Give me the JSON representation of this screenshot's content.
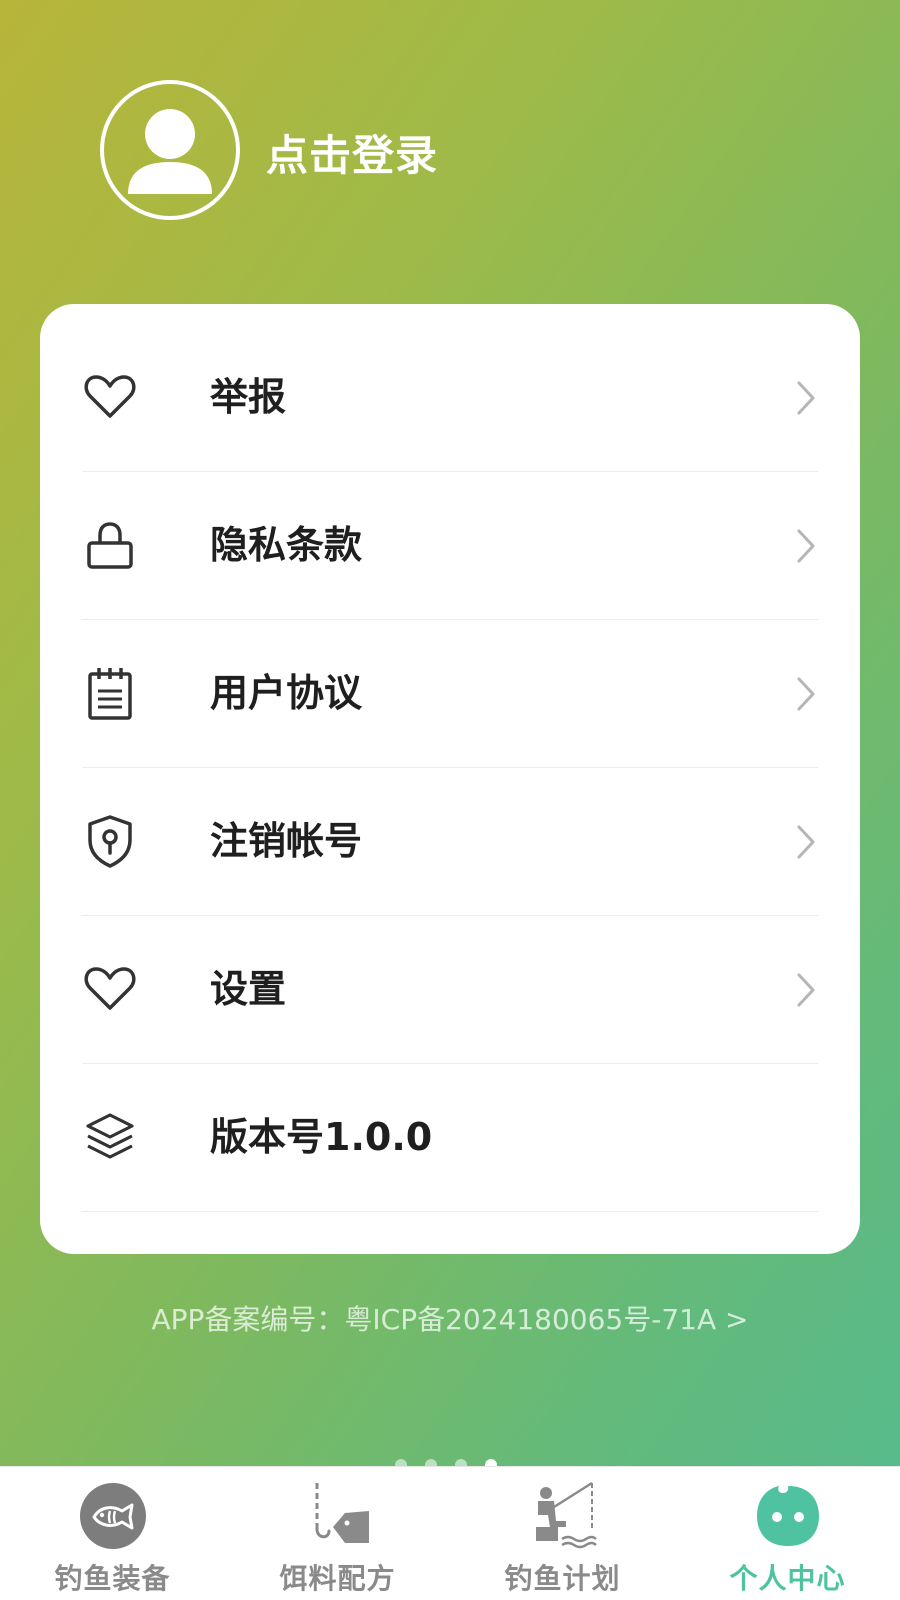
{
  "header": {
    "login_label": "点击登录"
  },
  "menu": {
    "items": [
      {
        "label": "举报",
        "icon": "heart-icon",
        "has_chevron": true
      },
      {
        "label": "隐私条款",
        "icon": "lock-icon",
        "has_chevron": true
      },
      {
        "label": "用户协议",
        "icon": "notepad-icon",
        "has_chevron": true
      },
      {
        "label": "注销帐号",
        "icon": "shield-keyhole-icon",
        "has_chevron": true
      },
      {
        "label": "设置",
        "icon": "heart-icon",
        "has_chevron": true
      },
      {
        "label": "版本号1.0.0",
        "icon": "layers-icon",
        "has_chevron": false
      }
    ]
  },
  "footer": {
    "icp_text": "APP备案编号：粤ICP备2024180065号-71A >"
  },
  "tabbar": {
    "tabs": [
      {
        "label": "钓鱼装备",
        "icon": "fish-icon",
        "active": false
      },
      {
        "label": "饵料配方",
        "icon": "hook-bait-icon",
        "active": false
      },
      {
        "label": "钓鱼计划",
        "icon": "fisherman-icon",
        "active": false
      },
      {
        "label": "个人中心",
        "icon": "smiley-face-icon",
        "active": true
      }
    ]
  },
  "colors": {
    "accent": "#4fc3a1",
    "gradient_start": "#b8b53a",
    "gradient_end": "#55bb90",
    "inactive_tab": "#8a8a8a"
  },
  "pager": {
    "count": 4,
    "active_index": 3
  }
}
